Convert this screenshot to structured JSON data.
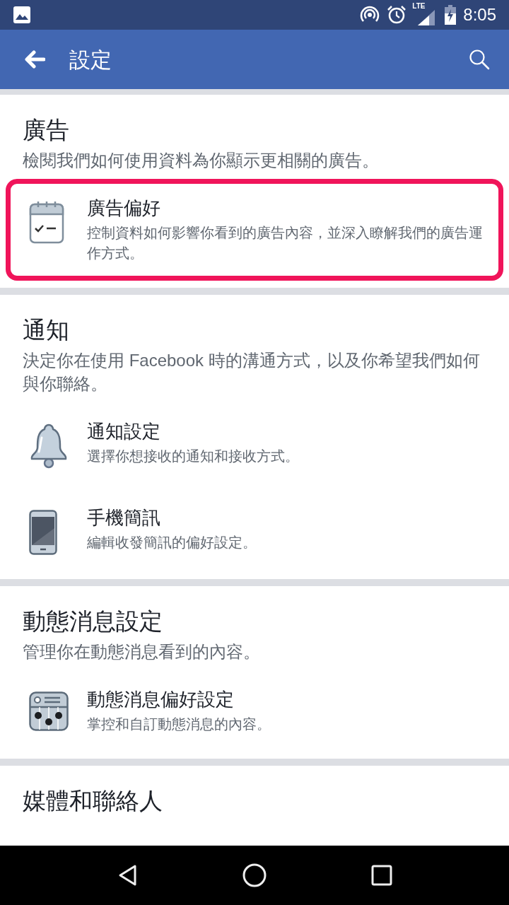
{
  "status_bar": {
    "network": "LTE",
    "time": "8:05"
  },
  "app_bar": {
    "title": "設定"
  },
  "sections": [
    {
      "heading": "廣告",
      "description": "檢閱我們如何使用資料為你顯示更相關的廣告。",
      "items": [
        {
          "title": "廣告偏好",
          "description": "控制資料如何影響你看到的廣告內容，並深入瞭解我們的廣告運作方式。",
          "highlighted": true
        }
      ]
    },
    {
      "heading": "通知",
      "description": "決定你在使用 Facebook 時的溝通方式，以及你希望我們如何與你聯絡。",
      "items": [
        {
          "title": "通知設定",
          "description": "選擇你想接收的通知和接收方式。",
          "highlighted": false
        },
        {
          "title": "手機簡訊",
          "description": "編輯收發簡訊的偏好設定。",
          "highlighted": false
        }
      ]
    },
    {
      "heading": "動態消息設定",
      "description": "管理你在動態消息看到的內容。",
      "items": [
        {
          "title": "動態消息偏好設定",
          "description": "掌控和自訂動態消息的內容。",
          "highlighted": false
        }
      ]
    },
    {
      "heading": "媒體和聯絡人"
    }
  ]
}
